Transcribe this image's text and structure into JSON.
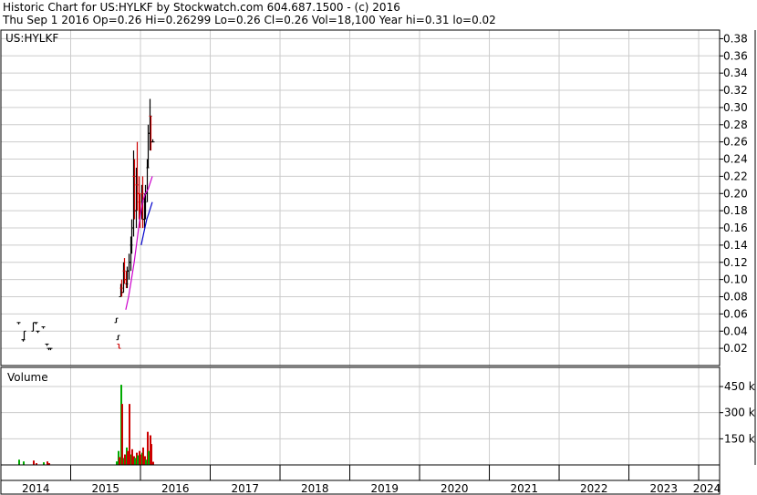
{
  "header": {
    "line1": "Historic Chart for US:HYLKF by Stockwatch.com 604.687.1500 - (c) 2016",
    "line2": "Thu Sep  1 2016  Op=0.26  Hi=0.26299  Lo=0.26  Cl=0.26  Vol=18,100  Year hi=0.31  lo=0.02"
  },
  "chart_data": [
    {
      "type": "candlestick",
      "title": "US:HYLKF",
      "ylim": [
        0,
        0.39
      ],
      "y_ticks": [
        "0.38",
        "0.36",
        "0.34",
        "0.32",
        "0.30",
        "0.28",
        "0.26",
        "0.24",
        "0.22",
        "0.20",
        "0.18",
        "0.16",
        "0.14",
        "0.12",
        "0.10",
        "0.08",
        "0.06",
        "0.04",
        "0.02"
      ],
      "x_ticks": [
        "2014",
        "2015",
        "2016",
        "2017",
        "2018",
        "2019",
        "2020",
        "2021",
        "2022",
        "2023",
        "2024"
      ],
      "grid": true,
      "colors": {
        "up": "#000000",
        "down": "#cc0000",
        "ma_short": "#cc00cc",
        "ma_long": "#0000cc",
        "grid": "#cccccc"
      },
      "ohlc": [
        {
          "t": 2014.25,
          "o": 0.05,
          "h": 0.05,
          "l": 0.05,
          "c": 0.05
        },
        {
          "t": 2014.31,
          "o": 0.03,
          "h": 0.03,
          "l": 0.03,
          "c": 0.03
        },
        {
          "t": 2014.33,
          "o": 0.03,
          "h": 0.04,
          "l": 0.03,
          "c": 0.04
        },
        {
          "t": 2014.46,
          "o": 0.04,
          "h": 0.05,
          "l": 0.04,
          "c": 0.05
        },
        {
          "t": 2014.5,
          "o": 0.05,
          "h": 0.05,
          "l": 0.05,
          "c": 0.05
        },
        {
          "t": 2014.52,
          "o": 0.04,
          "h": 0.04,
          "l": 0.04,
          "c": 0.04
        },
        {
          "t": 2014.6,
          "o": 0.045,
          "h": 0.045,
          "l": 0.045,
          "c": 0.045
        },
        {
          "t": 2014.65,
          "o": 0.025,
          "h": 0.025,
          "l": 0.025,
          "c": 0.025
        },
        {
          "t": 2014.68,
          "o": 0.02,
          "h": 0.02,
          "l": 0.02,
          "c": 0.02
        },
        {
          "t": 2014.7,
          "o": 0.02,
          "h": 0.02,
          "l": 0.02,
          "c": 0.02
        },
        {
          "t": 2015.65,
          "o": 0.05,
          "h": 0.055,
          "l": 0.05,
          "c": 0.055
        },
        {
          "t": 2015.67,
          "o": 0.03,
          "h": 0.035,
          "l": 0.03,
          "c": 0.035
        },
        {
          "t": 2015.69,
          "o": 0.025,
          "h": 0.025,
          "l": 0.02,
          "c": 0.02
        },
        {
          "t": 2015.71,
          "o": 0.08,
          "h": 0.095,
          "l": 0.08,
          "c": 0.09
        },
        {
          "t": 2015.73,
          "o": 0.09,
          "h": 0.1,
          "l": 0.08,
          "c": 0.085
        },
        {
          "t": 2015.75,
          "o": 0.085,
          "h": 0.12,
          "l": 0.085,
          "c": 0.11
        },
        {
          "t": 2015.77,
          "o": 0.11,
          "h": 0.125,
          "l": 0.095,
          "c": 0.1
        },
        {
          "t": 2015.79,
          "o": 0.1,
          "h": 0.11,
          "l": 0.09,
          "c": 0.095
        },
        {
          "t": 2015.81,
          "o": 0.095,
          "h": 0.115,
          "l": 0.09,
          "c": 0.11
        },
        {
          "t": 2015.83,
          "o": 0.11,
          "h": 0.13,
          "l": 0.1,
          "c": 0.12
        },
        {
          "t": 2015.85,
          "o": 0.12,
          "h": 0.15,
          "l": 0.11,
          "c": 0.14
        },
        {
          "t": 2015.87,
          "o": 0.14,
          "h": 0.17,
          "l": 0.13,
          "c": 0.16
        },
        {
          "t": 2015.89,
          "o": 0.16,
          "h": 0.25,
          "l": 0.15,
          "c": 0.22
        },
        {
          "t": 2015.91,
          "o": 0.22,
          "h": 0.24,
          "l": 0.17,
          "c": 0.18
        },
        {
          "t": 2015.93,
          "o": 0.18,
          "h": 0.23,
          "l": 0.16,
          "c": 0.21
        },
        {
          "t": 2015.95,
          "o": 0.21,
          "h": 0.26,
          "l": 0.18,
          "c": 0.2
        },
        {
          "t": 2015.97,
          "o": 0.2,
          "h": 0.22,
          "l": 0.17,
          "c": 0.19
        },
        {
          "t": 2015.99,
          "o": 0.19,
          "h": 0.2,
          "l": 0.16,
          "c": 0.18
        },
        {
          "t": 2016.01,
          "o": 0.18,
          "h": 0.21,
          "l": 0.17,
          "c": 0.2
        },
        {
          "t": 2016.03,
          "o": 0.2,
          "h": 0.22,
          "l": 0.16,
          "c": 0.17
        },
        {
          "t": 2016.05,
          "o": 0.17,
          "h": 0.2,
          "l": 0.16,
          "c": 0.19
        },
        {
          "t": 2016.07,
          "o": 0.19,
          "h": 0.21,
          "l": 0.17,
          "c": 0.2
        },
        {
          "t": 2016.09,
          "o": 0.2,
          "h": 0.24,
          "l": 0.19,
          "c": 0.23
        },
        {
          "t": 2016.11,
          "o": 0.23,
          "h": 0.28,
          "l": 0.23,
          "c": 0.27
        },
        {
          "t": 2016.13,
          "o": 0.27,
          "h": 0.31,
          "l": 0.25,
          "c": 0.29
        },
        {
          "t": 2016.15,
          "o": 0.29,
          "h": 0.29,
          "l": 0.25,
          "c": 0.26
        },
        {
          "t": 2016.17,
          "o": 0.26,
          "h": 0.263,
          "l": 0.26,
          "c": 0.26
        }
      ],
      "ma_short": [
        [
          2015.79,
          0.065
        ],
        [
          2015.83,
          0.08
        ],
        [
          2015.87,
          0.1
        ],
        [
          2015.91,
          0.12
        ],
        [
          2015.95,
          0.145
        ],
        [
          2015.99,
          0.17
        ],
        [
          2016.03,
          0.19
        ],
        [
          2016.07,
          0.2
        ],
        [
          2016.11,
          0.205
        ],
        [
          2016.15,
          0.215
        ],
        [
          2016.17,
          0.22
        ]
      ],
      "ma_long": [
        [
          2016.01,
          0.14
        ],
        [
          2016.05,
          0.155
        ],
        [
          2016.09,
          0.17
        ],
        [
          2016.13,
          0.18
        ],
        [
          2016.17,
          0.19
        ]
      ]
    },
    {
      "type": "bar",
      "title": "Volume",
      "ylim": [
        0,
        560000
      ],
      "y_ticks": [
        {
          "label": "450 k",
          "value": 450000
        },
        {
          "label": "300 k",
          "value": 300000
        },
        {
          "label": "150 k",
          "value": 150000
        }
      ],
      "colors": {
        "up": "#00aa00",
        "down": "#cc0000"
      },
      "bars": [
        {
          "t": 2014.25,
          "v": 30000,
          "dir": "up"
        },
        {
          "t": 2014.31,
          "v": 20000,
          "dir": "up"
        },
        {
          "t": 2014.46,
          "v": 25000,
          "dir": "down"
        },
        {
          "t": 2014.5,
          "v": 10000,
          "dir": "down"
        },
        {
          "t": 2014.6,
          "v": 15000,
          "dir": "up"
        },
        {
          "t": 2014.65,
          "v": 20000,
          "dir": "down"
        },
        {
          "t": 2014.68,
          "v": 10000,
          "dir": "down"
        },
        {
          "t": 2015.65,
          "v": 20000,
          "dir": "up"
        },
        {
          "t": 2015.67,
          "v": 80000,
          "dir": "up"
        },
        {
          "t": 2015.69,
          "v": 45000,
          "dir": "down"
        },
        {
          "t": 2015.71,
          "v": 460000,
          "dir": "up"
        },
        {
          "t": 2015.73,
          "v": 350000,
          "dir": "down"
        },
        {
          "t": 2015.75,
          "v": 40000,
          "dir": "up"
        },
        {
          "t": 2015.77,
          "v": 60000,
          "dir": "down"
        },
        {
          "t": 2015.79,
          "v": 100000,
          "dir": "up"
        },
        {
          "t": 2015.81,
          "v": 80000,
          "dir": "down"
        },
        {
          "t": 2015.83,
          "v": 350000,
          "dir": "down"
        },
        {
          "t": 2015.85,
          "v": 60000,
          "dir": "up"
        },
        {
          "t": 2015.87,
          "v": 90000,
          "dir": "down"
        },
        {
          "t": 2015.89,
          "v": 50000,
          "dir": "down"
        },
        {
          "t": 2015.91,
          "v": 40000,
          "dir": "up"
        },
        {
          "t": 2015.93,
          "v": 70000,
          "dir": "down"
        },
        {
          "t": 2015.95,
          "v": 55000,
          "dir": "up"
        },
        {
          "t": 2015.97,
          "v": 80000,
          "dir": "down"
        },
        {
          "t": 2015.99,
          "v": 60000,
          "dir": "down"
        },
        {
          "t": 2016.01,
          "v": 70000,
          "dir": "up"
        },
        {
          "t": 2016.03,
          "v": 100000,
          "dir": "down"
        },
        {
          "t": 2016.05,
          "v": 50000,
          "dir": "down"
        },
        {
          "t": 2016.07,
          "v": 30000,
          "dir": "up"
        },
        {
          "t": 2016.09,
          "v": 190000,
          "dir": "down"
        },
        {
          "t": 2016.11,
          "v": 80000,
          "dir": "up"
        },
        {
          "t": 2016.13,
          "v": 170000,
          "dir": "down"
        },
        {
          "t": 2016.15,
          "v": 120000,
          "dir": "down"
        },
        {
          "t": 2016.17,
          "v": 18100,
          "dir": "down"
        }
      ]
    }
  ]
}
